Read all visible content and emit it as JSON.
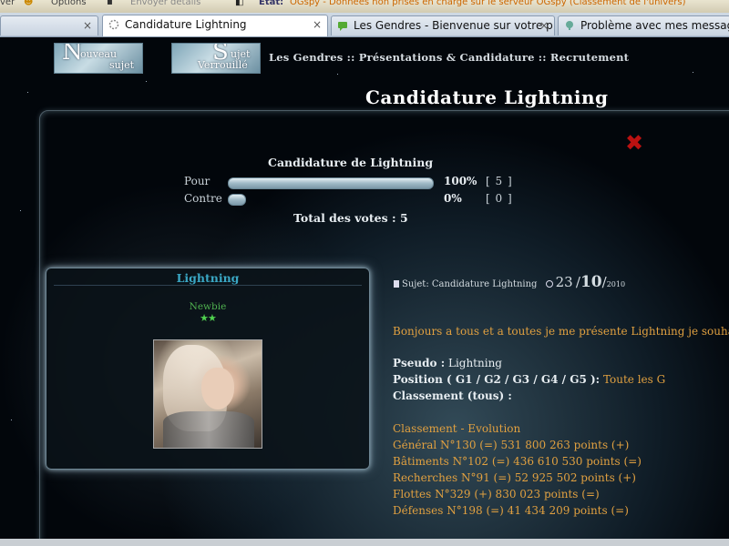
{
  "menubar": {
    "items": [
      "ver",
      "Options",
      "Envoyer détails",
      "Etat:",
      "OGspy - Données non prises en charge sur le serveur OGspy (Classement de l'univers)"
    ]
  },
  "browser": {
    "tabs": [
      {
        "label": "",
        "active": false
      },
      {
        "label": "Candidature Lightning",
        "active": true
      },
      {
        "label": "Les Gendres - Bienvenue sur votre p...",
        "active": false
      },
      {
        "label": "Problème avec mes messages",
        "active": false
      }
    ],
    "close_glyph": "×"
  },
  "toolbar": {
    "new_topic": {
      "big": "N",
      "line1": "ouveau",
      "line2": "sujet"
    },
    "locked_topic": {
      "big": "S",
      "line1": "ujet",
      "line2": "Verrouillé"
    }
  },
  "breadcrumb": "Les Gendres :: Présentations & Candidature :: Recrutement",
  "page_title": "Candidature Lightning",
  "close_icon_glyph": "✖",
  "poll": {
    "title": "Candidature de Lightning",
    "options": [
      {
        "label": "Pour",
        "percent_text": "100%",
        "votes_text": "[ 5 ]",
        "fraction": 1.0
      },
      {
        "label": "Contre",
        "percent_text": "0%",
        "votes_text": "[ 0 ]",
        "fraction": 0.0
      }
    ],
    "total": "Total des votes : 5"
  },
  "author": {
    "name": "Lightning",
    "rank": "Newbie",
    "stars": "★★"
  },
  "post": {
    "subject_label": "Sujet:",
    "subject": "Candidature Lightning",
    "date_day": "23",
    "date_month": "10",
    "date_year": "2010",
    "intro": "Bonjours a tous et a toutes je me présente Lightning je souhaiter",
    "pseudo_label": "Pseudo :",
    "pseudo_value": "Lightning",
    "position_label": "Position ( G1 / G2 / G3 / G4 / G5 ):",
    "position_value": "Toute les G",
    "classement_label": "Classement (tous) :",
    "evolution_title": "Classement - Evolution",
    "rankings": [
      "Général N°130 (=) 531 800 263 points (+)",
      "Bâtiments N°102 (=) 436 610 530 points (=)",
      "Recherches N°91 (=) 52 925 502 points (+)",
      "Flottes N°329 (+) 830 023 points (=)",
      "Défenses N°198 (=) 41 434 209 points (=)"
    ]
  },
  "statusbar": "",
  "colors": {
    "accent_orange": "#e0a040",
    "author_name": "#3aa7c4",
    "rank_green": "#4fb24f",
    "close_red": "#bb1111"
  }
}
